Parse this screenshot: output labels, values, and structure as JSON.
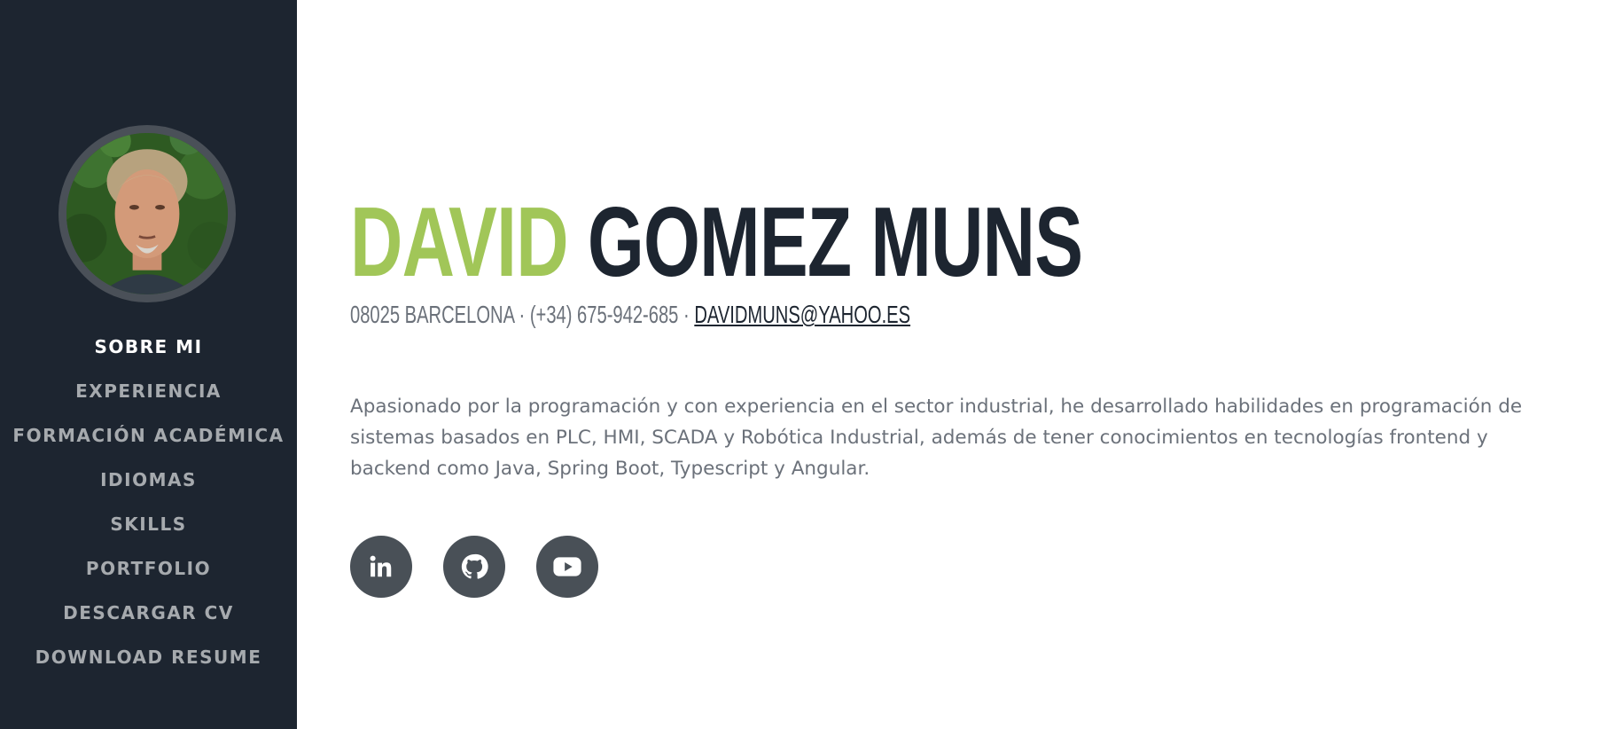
{
  "sidebar": {
    "nav_items": [
      {
        "label": "SOBRE MI",
        "active": true
      },
      {
        "label": "EXPERIENCIA",
        "active": false
      },
      {
        "label": "FORMACIÓN ACADÉMICA",
        "active": false
      },
      {
        "label": "IDIOMAS",
        "active": false
      },
      {
        "label": "SKILLS",
        "active": false
      },
      {
        "label": "PORTFOLIO",
        "active": false
      },
      {
        "label": "DESCARGAR CV",
        "active": false
      },
      {
        "label": "DOWNLOAD RESUME",
        "active": false
      }
    ]
  },
  "header": {
    "first_name": "DAVID",
    "last_name": "GOMEZ MUNS",
    "location": "08025 BARCELONA",
    "phone": "(+34) 675-942-685",
    "email": "DAVIDMUNS@YAHOO.ES",
    "separator": "·"
  },
  "bio": "Apasionado por la programación y con experiencia en el sector industrial, he desarrollado habilidades en programación de sistemas basados en PLC, HMI, SCADA y Robótica Industrial, además de tener conocimientos en tecnologías frontend y backend como Java, Spring Boot, Typescript y Angular.",
  "social": [
    {
      "icon": "linkedin-icon"
    },
    {
      "icon": "github-icon"
    },
    {
      "icon": "youtube-icon"
    }
  ],
  "colors": {
    "sidebar_bg": "#1d2530",
    "accent": "#a1c658",
    "dark_text": "#1d2530",
    "muted_text": "#6b717a",
    "nav_inactive": "#a6aaae",
    "social_bg": "#495057"
  }
}
